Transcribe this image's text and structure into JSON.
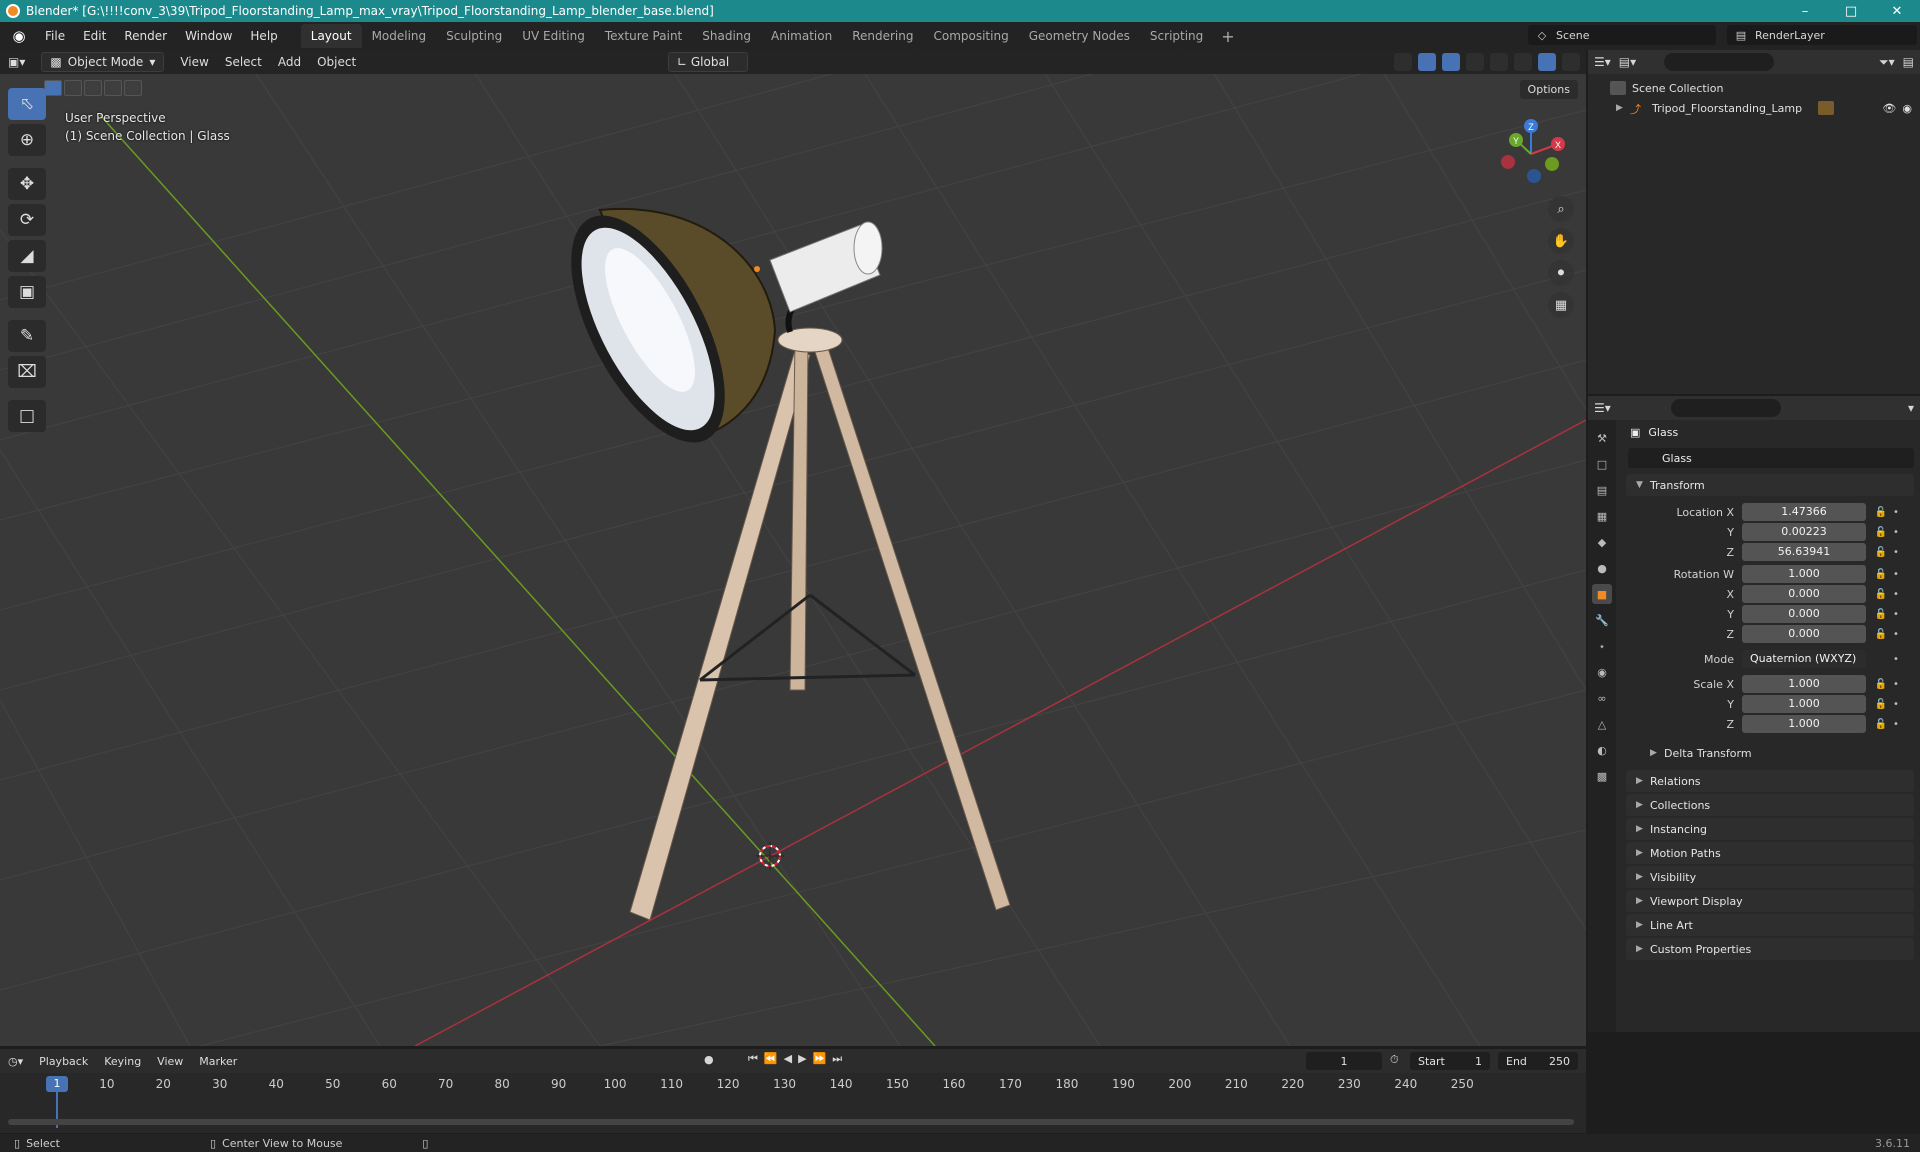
{
  "window": {
    "title": "Blender* [G:\\!!!!conv_3\\39\\Tripod_Floorstanding_Lamp_max_vray\\Tripod_Floorstanding_Lamp_blender_base.blend]"
  },
  "menubar": {
    "menus": [
      "File",
      "Edit",
      "Render",
      "Window",
      "Help"
    ],
    "workspaces": [
      "Layout",
      "Modeling",
      "Sculpting",
      "UV Editing",
      "Texture Paint",
      "Shading",
      "Animation",
      "Rendering",
      "Compositing",
      "Geometry Nodes",
      "Scripting"
    ],
    "active_workspace": "Layout",
    "scene": "Scene",
    "render_layer": "RenderLayer"
  },
  "viewport": {
    "mode": "Object Mode",
    "menus": [
      "View",
      "Select",
      "Add",
      "Object"
    ],
    "orientation": "Global",
    "options_label": "Options",
    "info_line1": "User Perspective",
    "info_line2": "(1) Scene Collection | Glass",
    "gizmo_axes": {
      "x": "X",
      "y": "Y",
      "z": "Z"
    }
  },
  "outliner": {
    "root": "Scene Collection",
    "items": [
      {
        "label": "Tripod_Floorstanding_Lamp"
      }
    ]
  },
  "properties": {
    "object_name": "Glass",
    "name_field": "Glass",
    "transform": {
      "title": "Transform",
      "location_label": "Location X",
      "location": [
        "1.47366",
        "0.00223",
        "56.63941"
      ],
      "rotation_label": "Rotation W",
      "rotation": [
        "1.000",
        "0.000",
        "0.000",
        "0.000"
      ],
      "mode_label": "Mode",
      "mode_value": "Quaternion (WXYZ)",
      "scale_label": "Scale X",
      "scale": [
        "1.000",
        "1.000",
        "1.000"
      ],
      "axis_y": "Y",
      "axis_z": "Z",
      "axis_x": "X",
      "delta": "Delta Transform"
    },
    "panels": [
      "Relations",
      "Collections",
      "Instancing",
      "Motion Paths",
      "Visibility",
      "Viewport Display",
      "Line Art",
      "Custom Properties"
    ]
  },
  "timeline": {
    "menus": [
      "Playback",
      "Keying",
      "View",
      "Marker"
    ],
    "current_frame": "1",
    "start_label": "Start",
    "start": "1",
    "end_label": "End",
    "end": "250",
    "ruler": [
      "1",
      "10",
      "20",
      "30",
      "40",
      "50",
      "60",
      "70",
      "80",
      "90",
      "100",
      "110",
      "120",
      "130",
      "140",
      "150",
      "160",
      "170",
      "180",
      "190",
      "200",
      "210",
      "220",
      "230",
      "240",
      "250"
    ]
  },
  "statusbar": {
    "select": "Select",
    "center": "Center View to Mouse",
    "version": "3.6.11"
  },
  "colors": {
    "accent": "#4772b3",
    "titlebar": "#1c8a8c",
    "object_orange": "#f08a24",
    "x_axis": "#c0392b",
    "y_axis": "#6b9a1e"
  }
}
